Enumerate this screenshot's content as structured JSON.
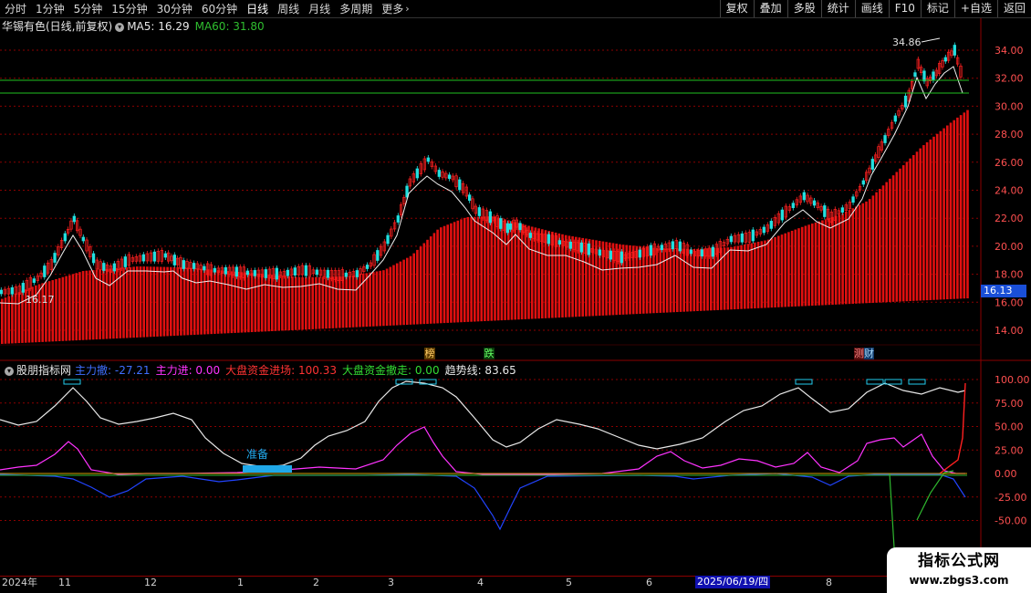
{
  "toolbar": {
    "periods": [
      "分时",
      "1分钟",
      "5分钟",
      "15分钟",
      "30分钟",
      "60分钟",
      "日线",
      "周线",
      "月线",
      "多周期",
      "更多"
    ],
    "active_index": 6,
    "more_icon": "chevron-right-icon",
    "right_buttons": [
      "复权",
      "叠加",
      "多股",
      "统计",
      "画线",
      "F10",
      "标记",
      "+自选",
      "返回"
    ]
  },
  "stock": {
    "title": "华锡有色(日线,前复权)",
    "info_icon": "circle-dropdown-icon",
    "ma5_label": "MA5: 16.29",
    "ma60_label": "MA60: 31.80",
    "high_label": "34.86",
    "low_label": "16.17",
    "current_price": "16.13",
    "marker_bang": "榜",
    "marker_die": "跌",
    "marker_cai": "财",
    "marker_cai_prefix": "测"
  },
  "price_axis": {
    "ticks": [
      "34.00",
      "32.00",
      "30.00",
      "28.00",
      "26.00",
      "24.00",
      "22.00",
      "20.00",
      "18.00",
      "16.00",
      "14.00"
    ]
  },
  "indicator": {
    "name": "股朋指标网",
    "main_out": "主力撤: -27.21",
    "main_in": "主力进: 0.00",
    "big_in": "大盘资金进场: 100.33",
    "big_out": "大盘资金撤走: 0.00",
    "trend": "趋势线: 83.65",
    "ready_label": "准备",
    "axis_ticks": [
      "100.00",
      "75.00",
      "50.00",
      "25.00",
      "0.00",
      "-25.00",
      "-50.00"
    ]
  },
  "date_axis": {
    "labels": [
      "2024年",
      "11",
      "12",
      "1",
      "2",
      "3",
      "4",
      "5",
      "6",
      "8"
    ],
    "highlight": "2025/06/19/四"
  },
  "colors": {
    "red": "#ff2020",
    "green": "#00cc00",
    "grid": "#8b0000",
    "trend": "#e8e8e8",
    "magenta": "#ff33ff",
    "blue": "#2244ff",
    "cyan": "#22ccee"
  },
  "watermark": {
    "title": "指标公式网",
    "url": "www.zbgs3.com"
  }
}
